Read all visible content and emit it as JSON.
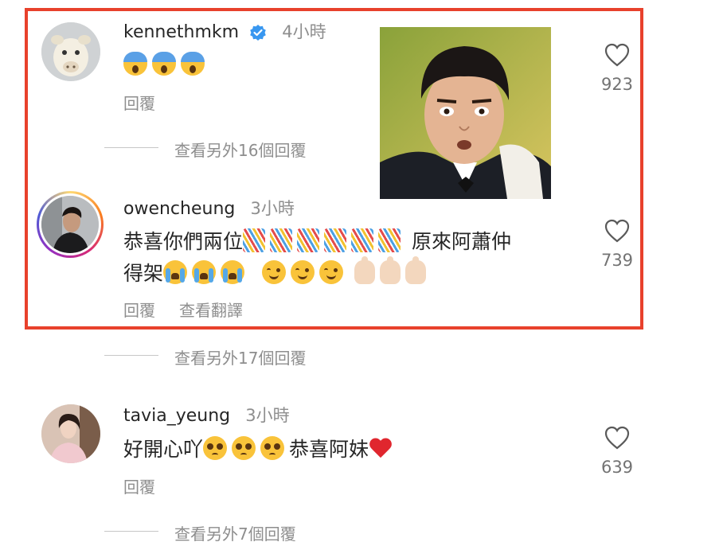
{
  "comments": [
    {
      "username": "kennethmkm",
      "verified": true,
      "time": "4小時",
      "text_parts": [],
      "emojis": [
        "shock",
        "shock",
        "shock"
      ],
      "reply_label": "回覆",
      "likes": "923",
      "view_replies": "查看另外16個回覆"
    },
    {
      "username": "owencheung",
      "time": "3小時",
      "text_start": "恭喜你們兩位",
      "text_mid": "原來阿蕭仲",
      "text_line2": "得架",
      "emojis_party": [
        "party",
        "party",
        "party",
        "party",
        "party",
        "party"
      ],
      "emojis_cry": [
        "cry",
        "cry",
        "cry"
      ],
      "emojis_smile": [
        "smile",
        "smile",
        "smile"
      ],
      "emojis_thumb": [
        "thumbs-up",
        "thumbs-up",
        "thumbs-up"
      ],
      "reply_label": "回覆",
      "translate_label": "查看翻譯",
      "likes": "739",
      "view_replies": "查看另外17個回覆"
    },
    {
      "username": "tavia_yeung",
      "time": "3小時",
      "text_start": "好開心吖",
      "text_end": "恭喜阿妹",
      "emojis_plead": [
        "pleading",
        "pleading",
        "pleading"
      ],
      "emoji_heart": "red-heart",
      "reply_label": "回覆",
      "likes": "639",
      "view_replies": "查看另外7個回覆"
    }
  ],
  "colors": {
    "highlight": "#e8412c",
    "verified": "#3897f0",
    "muted": "#8e8e8e"
  }
}
